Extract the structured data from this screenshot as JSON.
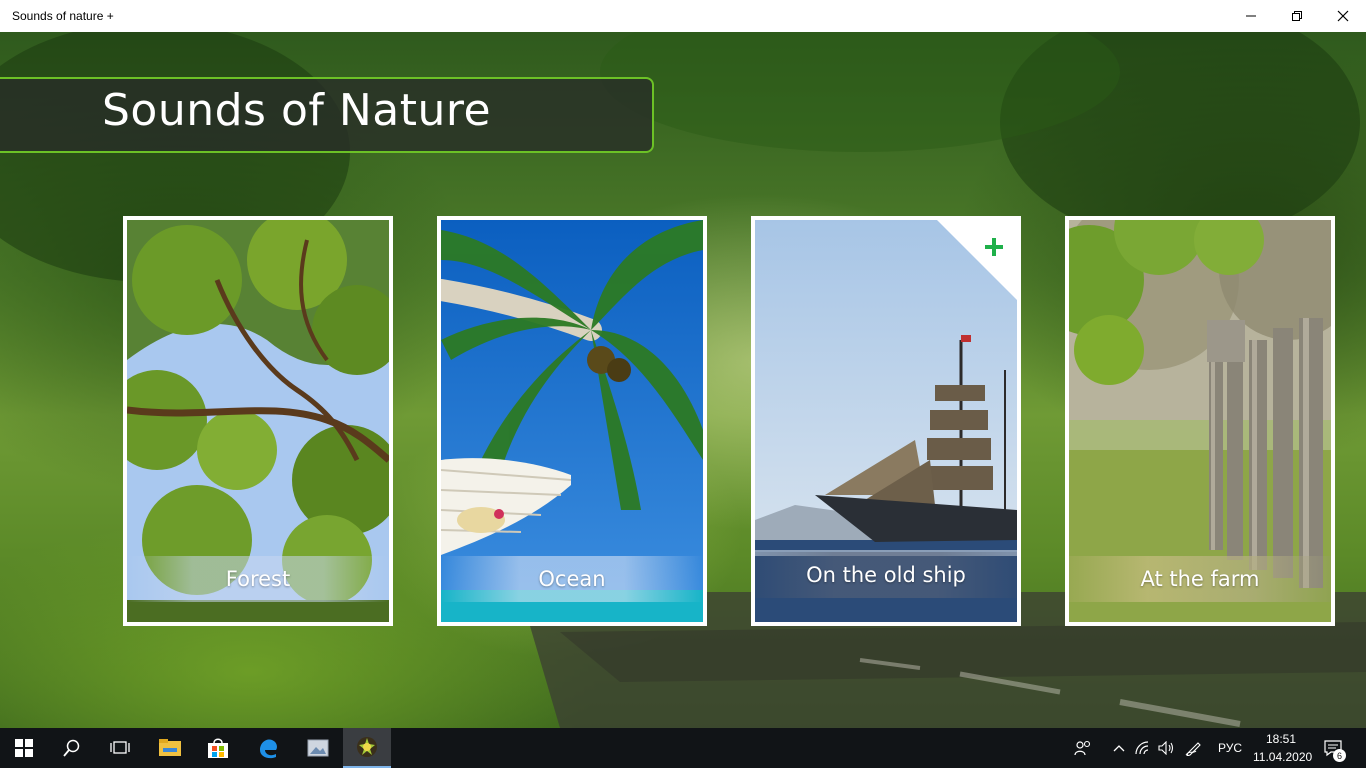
{
  "window": {
    "title": "Sounds of nature +",
    "controls": [
      "minimize-icon",
      "restore-icon",
      "close-icon"
    ]
  },
  "header": {
    "title": "Sounds of Nature"
  },
  "cards": [
    {
      "label": "Forest",
      "image": "tree-branches"
    },
    {
      "label": "Ocean",
      "image": "palm-hammock"
    },
    {
      "label": "On the old ship",
      "image": "sailing-ship",
      "badge": "plus-icon"
    },
    {
      "label": "At the farm",
      "image": "wooden-fence"
    }
  ],
  "taskbar": {
    "pinned": [
      "start-icon",
      "search-icon",
      "task-view-icon",
      "file-explorer-icon",
      "store-icon",
      "edge-icon",
      "photos-icon",
      "sounds-of-nature-app-icon"
    ],
    "active_app": "sounds-of-nature-app-icon",
    "tray": {
      "language": "РУС",
      "time": "18:51",
      "date": "11.04.2020",
      "notifications": "6"
    }
  },
  "colors": {
    "accent_border": "#6cc126",
    "plus_green": "#1fb04a",
    "taskbar": "#111417"
  }
}
